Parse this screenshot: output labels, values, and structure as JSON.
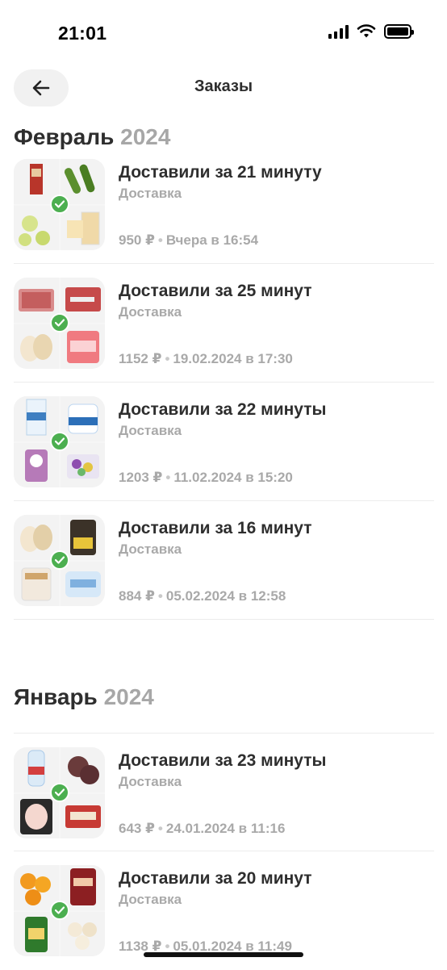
{
  "status_bar": {
    "time": "21:01"
  },
  "header": {
    "title": "Заказы"
  },
  "sections": [
    {
      "month": "Февраль",
      "year": "2024"
    },
    {
      "month": "Январь",
      "year": "2024"
    }
  ],
  "orders": [
    {
      "title": "Доставили за 21 минуту",
      "type": "Доставка",
      "price": "950 ₽",
      "date": "Вчера в 16:54"
    },
    {
      "title": "Доставили за 25 минут",
      "type": "Доставка",
      "price": "1152 ₽",
      "date": "19.02.2024 в 17:30"
    },
    {
      "title": "Доставили за 22 минуты",
      "type": "Доставка",
      "price": "1203 ₽",
      "date": "11.02.2024 в 15:20"
    },
    {
      "title": "Доставили за 16 минут",
      "type": "Доставка",
      "price": "884 ₽",
      "date": "05.02.2024 в 12:58"
    },
    {
      "title": "Доставили за 23 минуты",
      "type": "Доставка",
      "price": "643 ₽",
      "date": "24.01.2024 в 11:16"
    },
    {
      "title": "Доставили за 20 минут",
      "type": "Доставка",
      "price": "1138 ₽",
      "date": "05.01.2024 в 11:49"
    }
  ],
  "icons": {
    "back": "arrow-left-icon",
    "check": "checkmark-icon",
    "signal": "signal-icon",
    "wifi": "wifi-icon",
    "battery": "battery-icon"
  },
  "colors": {
    "check_green": "#4caf50",
    "muted_text": "#a9a9a9"
  },
  "separator": "•"
}
